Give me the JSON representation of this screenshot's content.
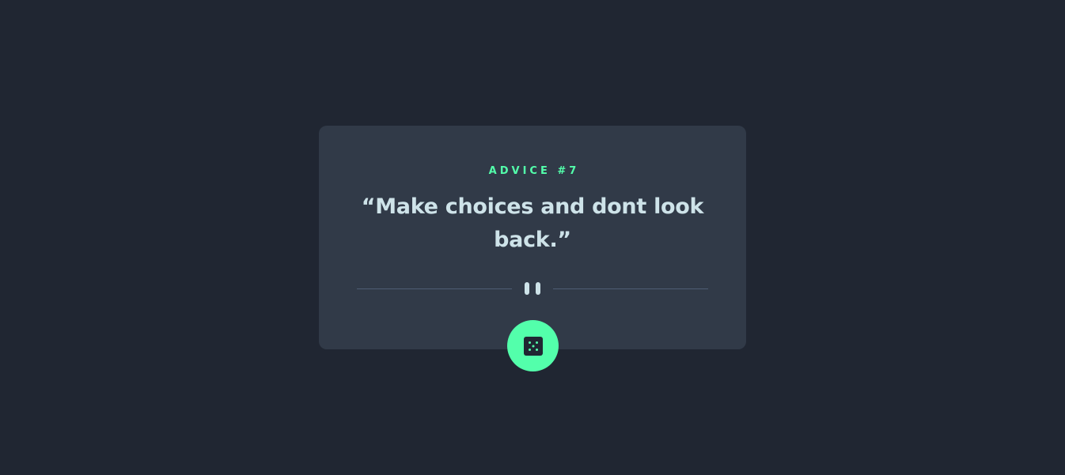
{
  "card": {
    "advice_label": "ADVICE #7",
    "quote": "“Make choices and dont look back.”"
  },
  "icons": {
    "divider": "pause-icon",
    "button": "dice-icon"
  },
  "colors": {
    "background": "#202632",
    "card": "#313a48",
    "accent": "#53ffab",
    "text": "#cee3e9",
    "divider": "#4f5d74"
  }
}
